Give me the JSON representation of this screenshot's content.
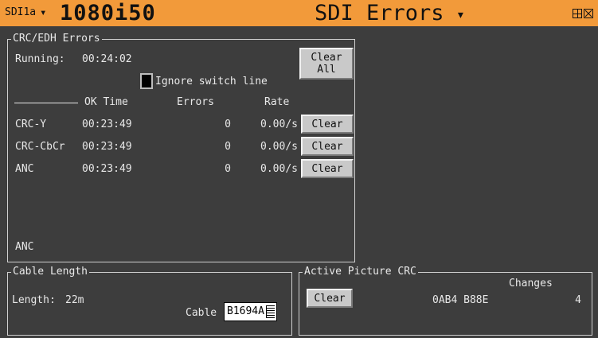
{
  "header": {
    "input": "SDI1a",
    "format": "1080i50",
    "title": "SDI Errors",
    "dropdown_caret": "▾",
    "restore_icon": "restore-icon",
    "close_icon": "close-icon"
  },
  "crc": {
    "legend": "CRC/EDH Errors",
    "running_label": "Running:",
    "running_value": "00:24:02",
    "clear_all_line1": "Clear",
    "clear_all_line2": "All",
    "ignore_switch_line": "Ignore switch line",
    "columns": [
      "OK Time",
      "Errors",
      "Rate"
    ],
    "rows": [
      {
        "name": "CRC-Y",
        "ok_time": "00:23:49",
        "errors": "0",
        "rate": "0.00/s",
        "button": "Clear"
      },
      {
        "name": "CRC-CbCr",
        "ok_time": "00:23:49",
        "errors": "0",
        "rate": "0.00/s",
        "button": "Clear"
      },
      {
        "name": "ANC",
        "ok_time": "00:23:49",
        "errors": "0",
        "rate": "0.00/s",
        "button": "Clear"
      }
    ],
    "footer": "ANC"
  },
  "cable": {
    "legend": "Cable Length",
    "length_label": "Length:",
    "length_value": "22m",
    "cable_label": "Cable",
    "cable_value": "B1694A"
  },
  "apcrc": {
    "legend": "Active Picture CRC",
    "clear": "Clear",
    "changes_label": "Changes",
    "crc_value": "0AB4 B88E",
    "changes_value": "4"
  },
  "colors": {
    "header_bg": "#f29a3a",
    "panel_bg": "#3d3d3d",
    "button_bg": "#c9c9c9"
  }
}
